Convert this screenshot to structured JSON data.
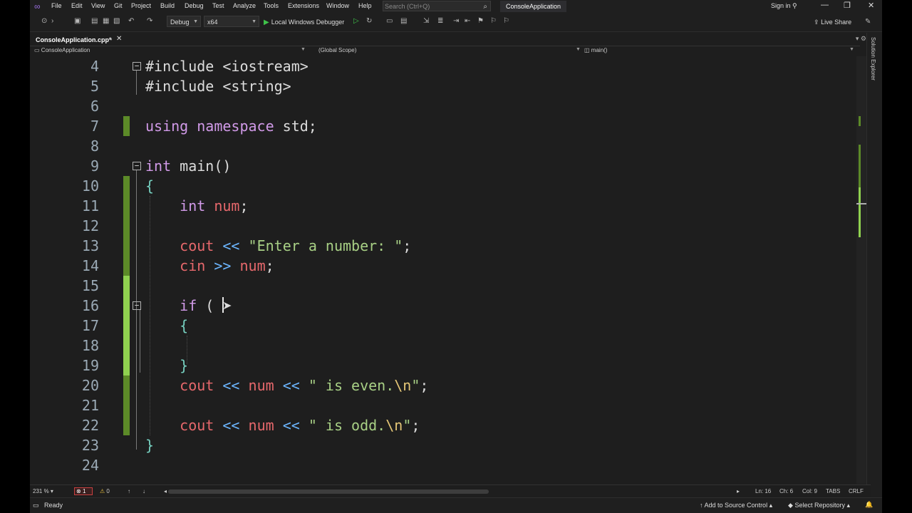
{
  "menu": [
    "File",
    "Edit",
    "View",
    "Git",
    "Project",
    "Build",
    "Debug",
    "Test",
    "Analyze",
    "Tools",
    "Extensions",
    "Window",
    "Help"
  ],
  "search": {
    "placeholder": "Search (Ctrl+Q)"
  },
  "solution_name": "ConsoleApplication",
  "sign_in": "Sign in",
  "toolbar": {
    "config": "Debug",
    "platform": "x64",
    "debugger": "Local Windows Debugger",
    "live_share": "Live Share"
  },
  "tab": {
    "label": "ConsoleApplication.cpp*"
  },
  "navbar": {
    "project": "ConsoleApplication",
    "scope": "(Global Scope)",
    "member": "main()"
  },
  "right_panel": {
    "label": "Solution Explorer"
  },
  "code_lines": [
    {
      "n": "4",
      "tokens": [
        {
          "t": "#include <iostream>",
          "c": ""
        }
      ]
    },
    {
      "n": "5",
      "tokens": [
        {
          "t": "#include <string>",
          "c": ""
        }
      ]
    },
    {
      "n": "6",
      "tokens": []
    },
    {
      "n": "7",
      "tokens": [
        {
          "t": "using namespace",
          "c": "kw"
        },
        {
          "t": " std;",
          "c": ""
        }
      ]
    },
    {
      "n": "8",
      "tokens": []
    },
    {
      "n": "9",
      "tokens": [
        {
          "t": "int",
          "c": "kw"
        },
        {
          "t": " main()",
          "c": ""
        }
      ]
    },
    {
      "n": "10",
      "tokens": [
        {
          "t": "{",
          "c": "brace"
        }
      ]
    },
    {
      "n": "11",
      "tokens": [
        {
          "t": "    ",
          "c": ""
        },
        {
          "t": "int",
          "c": "kw"
        },
        {
          "t": " ",
          "c": ""
        },
        {
          "t": "num",
          "c": "var"
        },
        {
          "t": ";",
          "c": ""
        }
      ]
    },
    {
      "n": "12",
      "tokens": []
    },
    {
      "n": "13",
      "tokens": [
        {
          "t": "    ",
          "c": ""
        },
        {
          "t": "cout",
          "c": "var"
        },
        {
          "t": " ",
          "c": ""
        },
        {
          "t": "<<",
          "c": "op"
        },
        {
          "t": " ",
          "c": ""
        },
        {
          "t": "\"Enter a number: \"",
          "c": "str"
        },
        {
          "t": ";",
          "c": ""
        }
      ]
    },
    {
      "n": "14",
      "tokens": [
        {
          "t": "    ",
          "c": ""
        },
        {
          "t": "cin",
          "c": "var"
        },
        {
          "t": " ",
          "c": ""
        },
        {
          "t": ">>",
          "c": "op"
        },
        {
          "t": " ",
          "c": ""
        },
        {
          "t": "num",
          "c": "var"
        },
        {
          "t": ";",
          "c": ""
        }
      ]
    },
    {
      "n": "15",
      "tokens": []
    },
    {
      "n": "16",
      "tokens": [
        {
          "t": "    ",
          "c": ""
        },
        {
          "t": "if",
          "c": "kw"
        },
        {
          "t": " (",
          "c": ""
        }
      ]
    },
    {
      "n": "17",
      "tokens": [
        {
          "t": "    ",
          "c": ""
        },
        {
          "t": "{",
          "c": "brace"
        }
      ]
    },
    {
      "n": "18",
      "tokens": []
    },
    {
      "n": "19",
      "tokens": [
        {
          "t": "    ",
          "c": ""
        },
        {
          "t": "}",
          "c": "brace"
        }
      ]
    },
    {
      "n": "20",
      "tokens": [
        {
          "t": "    ",
          "c": ""
        },
        {
          "t": "cout",
          "c": "var"
        },
        {
          "t": " ",
          "c": ""
        },
        {
          "t": "<<",
          "c": "op"
        },
        {
          "t": " ",
          "c": ""
        },
        {
          "t": "num",
          "c": "var"
        },
        {
          "t": " ",
          "c": ""
        },
        {
          "t": "<<",
          "c": "op"
        },
        {
          "t": " ",
          "c": ""
        },
        {
          "t": "\" is even.",
          "c": "str"
        },
        {
          "t": "\\n",
          "c": "esc"
        },
        {
          "t": "\"",
          "c": "str"
        },
        {
          "t": ";",
          "c": ""
        }
      ]
    },
    {
      "n": "21",
      "tokens": []
    },
    {
      "n": "22",
      "tokens": [
        {
          "t": "    ",
          "c": ""
        },
        {
          "t": "cout",
          "c": "var"
        },
        {
          "t": " ",
          "c": ""
        },
        {
          "t": "<<",
          "c": "op"
        },
        {
          "t": " ",
          "c": ""
        },
        {
          "t": "num",
          "c": "var"
        },
        {
          "t": " ",
          "c": ""
        },
        {
          "t": "<<",
          "c": "op"
        },
        {
          "t": " ",
          "c": ""
        },
        {
          "t": "\" is odd.",
          "c": "str"
        },
        {
          "t": "\\n",
          "c": "esc"
        },
        {
          "t": "\"",
          "c": "str"
        },
        {
          "t": ";",
          "c": ""
        }
      ]
    },
    {
      "n": "23",
      "tokens": [
        {
          "t": "}",
          "c": "brace"
        }
      ]
    },
    {
      "n": "24",
      "tokens": []
    }
  ],
  "status": {
    "zoom": "231 %",
    "errors": "1",
    "warnings": "0",
    "ln": "Ln: 16",
    "ch": "Ch: 6",
    "col": "Col: 9",
    "tabs": "TABS",
    "eol": "CRLF",
    "ready": "Ready",
    "add_source": "Add to Source Control",
    "select_repo": "Select Repository"
  },
  "colors": {
    "accent": "#9b6fe0",
    "saved_change": "#5c8a28",
    "unsaved_change": "#8fd14f"
  }
}
